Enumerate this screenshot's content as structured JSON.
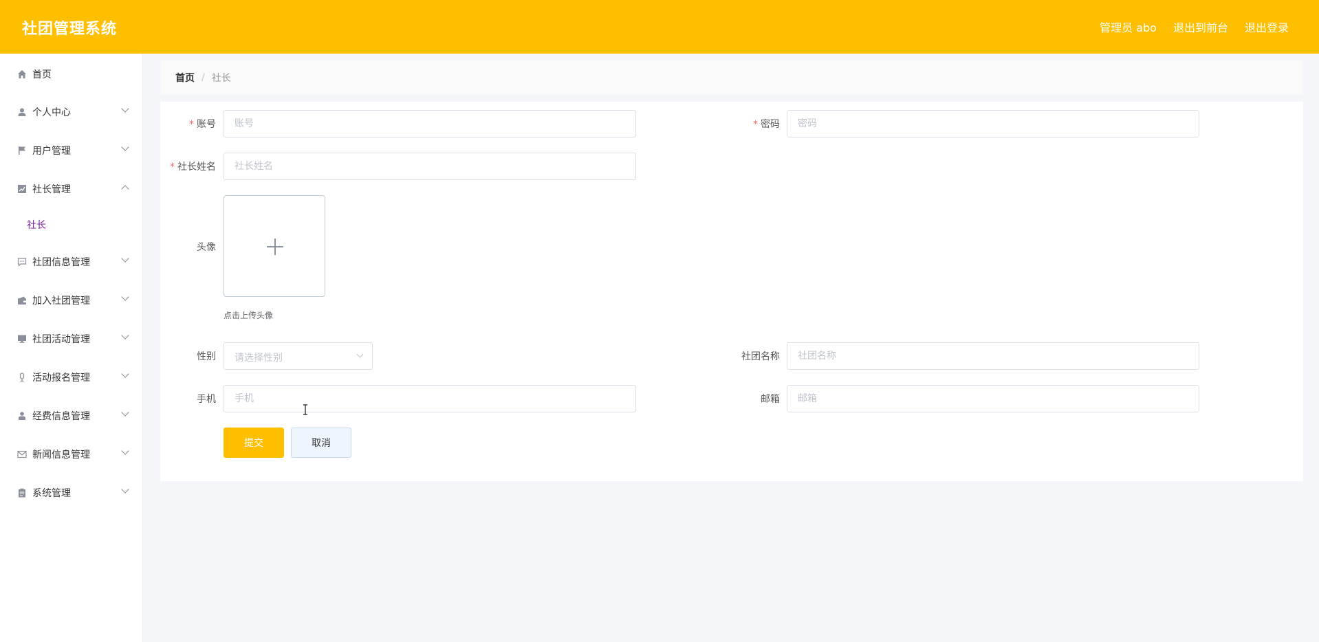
{
  "header": {
    "brand": "社团管理系统",
    "admin_label": "管理员 abo",
    "to_front": "退出到前台",
    "logout": "退出登录"
  },
  "sidebar": {
    "items": [
      {
        "label": "首页",
        "icon": "home-icon"
      },
      {
        "label": "个人中心",
        "icon": "user-icon"
      },
      {
        "label": "用户管理",
        "icon": "flag-icon"
      },
      {
        "label": "社长管理",
        "icon": "chart-icon",
        "expanded": true,
        "children": [
          {
            "label": "社长"
          }
        ]
      },
      {
        "label": "社团信息管理",
        "icon": "chat-icon"
      },
      {
        "label": "加入社团管理",
        "icon": "wallet-icon"
      },
      {
        "label": "社团活动管理",
        "icon": "monitor-icon"
      },
      {
        "label": "活动报名管理",
        "icon": "microphone-icon"
      },
      {
        "label": "经费信息管理",
        "icon": "person-icon"
      },
      {
        "label": "新闻信息管理",
        "icon": "mail-icon"
      },
      {
        "label": "系统管理",
        "icon": "clipboard-icon"
      }
    ]
  },
  "breadcrumb": {
    "home": "首页",
    "sep": "/",
    "current": "社长"
  },
  "form": {
    "account": {
      "label": "账号",
      "placeholder": "账号",
      "required": true
    },
    "password": {
      "label": "密码",
      "placeholder": "密码",
      "required": true
    },
    "name": {
      "label": "社长姓名",
      "placeholder": "社长姓名",
      "required": true
    },
    "avatar": {
      "label": "头像",
      "tip": "点击上传头像"
    },
    "gender": {
      "label": "性别",
      "placeholder": "请选择性别"
    },
    "club": {
      "label": "社团名称",
      "placeholder": "社团名称"
    },
    "phone": {
      "label": "手机",
      "placeholder": "手机"
    },
    "email": {
      "label": "邮箱",
      "placeholder": "邮箱"
    },
    "submit": "提交",
    "cancel": "取消"
  },
  "colors": {
    "accent": "#fdbf00",
    "submenu_active": "#7b1fa2",
    "required": "#f56c6c"
  }
}
